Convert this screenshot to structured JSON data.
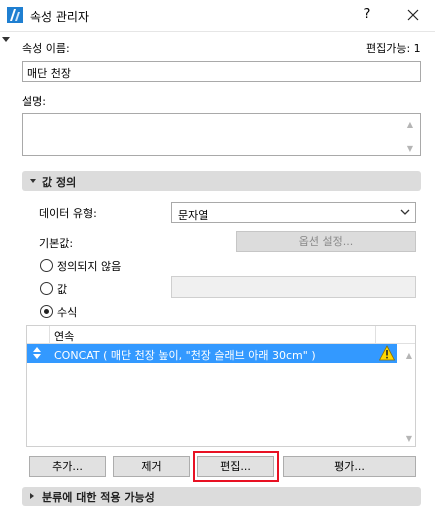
{
  "window": {
    "title": "속성 관리자",
    "help": "?",
    "icons": {
      "app": "archicad-icon",
      "close": "close-icon"
    }
  },
  "property": {
    "name_label": "속성 이름:",
    "editable_label": "편집가능: 1",
    "name_value": "매단 천장",
    "description_label": "설명:",
    "description_value": ""
  },
  "value_section": {
    "title": "값 정의",
    "data_type_label": "데이터 유형:",
    "data_type_value": "문자열",
    "default_label": "기본값:",
    "options_button": "옵션 설정...",
    "radio_undefined": "정의되지 않음",
    "radio_value": "값",
    "radio_formula": "수식",
    "selected_radio": "수식"
  },
  "formula_list": {
    "header": "연속",
    "rows": [
      {
        "text": "CONCAT ( 매단 천장 높이, \"천장 슬래브 아래 30cm\" )",
        "warning": true
      }
    ]
  },
  "buttons": {
    "add": "추가...",
    "remove": "제거",
    "edit": "편집...",
    "evaluate": "평가..."
  },
  "classification_section": {
    "title": "분류에 대한 적용 가능성"
  },
  "colors": {
    "selection": "#3399ff",
    "highlight": "#e81123",
    "warning": "#ffd700"
  }
}
